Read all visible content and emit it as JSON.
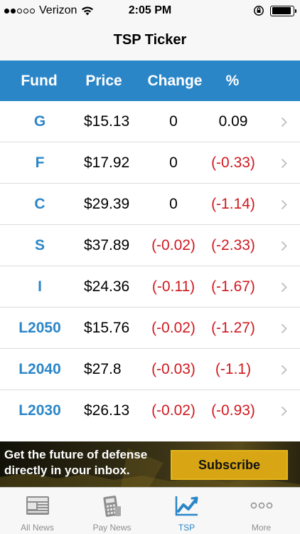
{
  "status_bar": {
    "carrier": "Verizon",
    "time": "2:05 PM",
    "signal_bars_filled": 2,
    "signal_bars_total": 5,
    "battery_level": 0.9
  },
  "nav": {
    "title": "TSP Ticker"
  },
  "table": {
    "headers": {
      "fund": "Fund",
      "price": "Price",
      "change": "Change",
      "pct": "%"
    },
    "rows": [
      {
        "fund": "G",
        "price": "$15.13",
        "change": "0",
        "pct": "0.09"
      },
      {
        "fund": "F",
        "price": "$17.92",
        "change": "0",
        "pct": "(-0.33)"
      },
      {
        "fund": "C",
        "price": "$29.39",
        "change": "0",
        "pct": "(-1.14)"
      },
      {
        "fund": "S",
        "price": "$37.89",
        "change": "(-0.02)",
        "pct": "(-2.33)"
      },
      {
        "fund": "I",
        "price": "$24.36",
        "change": "(-0.11)",
        "pct": "(-1.67)"
      },
      {
        "fund": "L2050",
        "price": "$15.76",
        "change": "(-0.02)",
        "pct": "(-1.27)"
      },
      {
        "fund": "L2040",
        "price": "$27.8",
        "change": "(-0.03)",
        "pct": "(-1.1)"
      },
      {
        "fund": "L2030",
        "price": "$26.13",
        "change": "(-0.02)",
        "pct": "(-0.93)"
      }
    ]
  },
  "ad": {
    "line1": "Get the future of defense",
    "line2": "directly in your inbox.",
    "button_label": "Subscribe"
  },
  "tabs": [
    {
      "label": "All News",
      "icon": "newspaper-icon",
      "active": false
    },
    {
      "label": "Pay News",
      "icon": "calculator-icon",
      "active": false
    },
    {
      "label": "TSP",
      "icon": "chart-icon",
      "active": true
    },
    {
      "label": "More",
      "icon": "more-dots-icon",
      "active": false
    }
  ],
  "colors": {
    "accent": "#2b86c8",
    "negative": "#d0191f",
    "ad_button": "#d8a614"
  }
}
